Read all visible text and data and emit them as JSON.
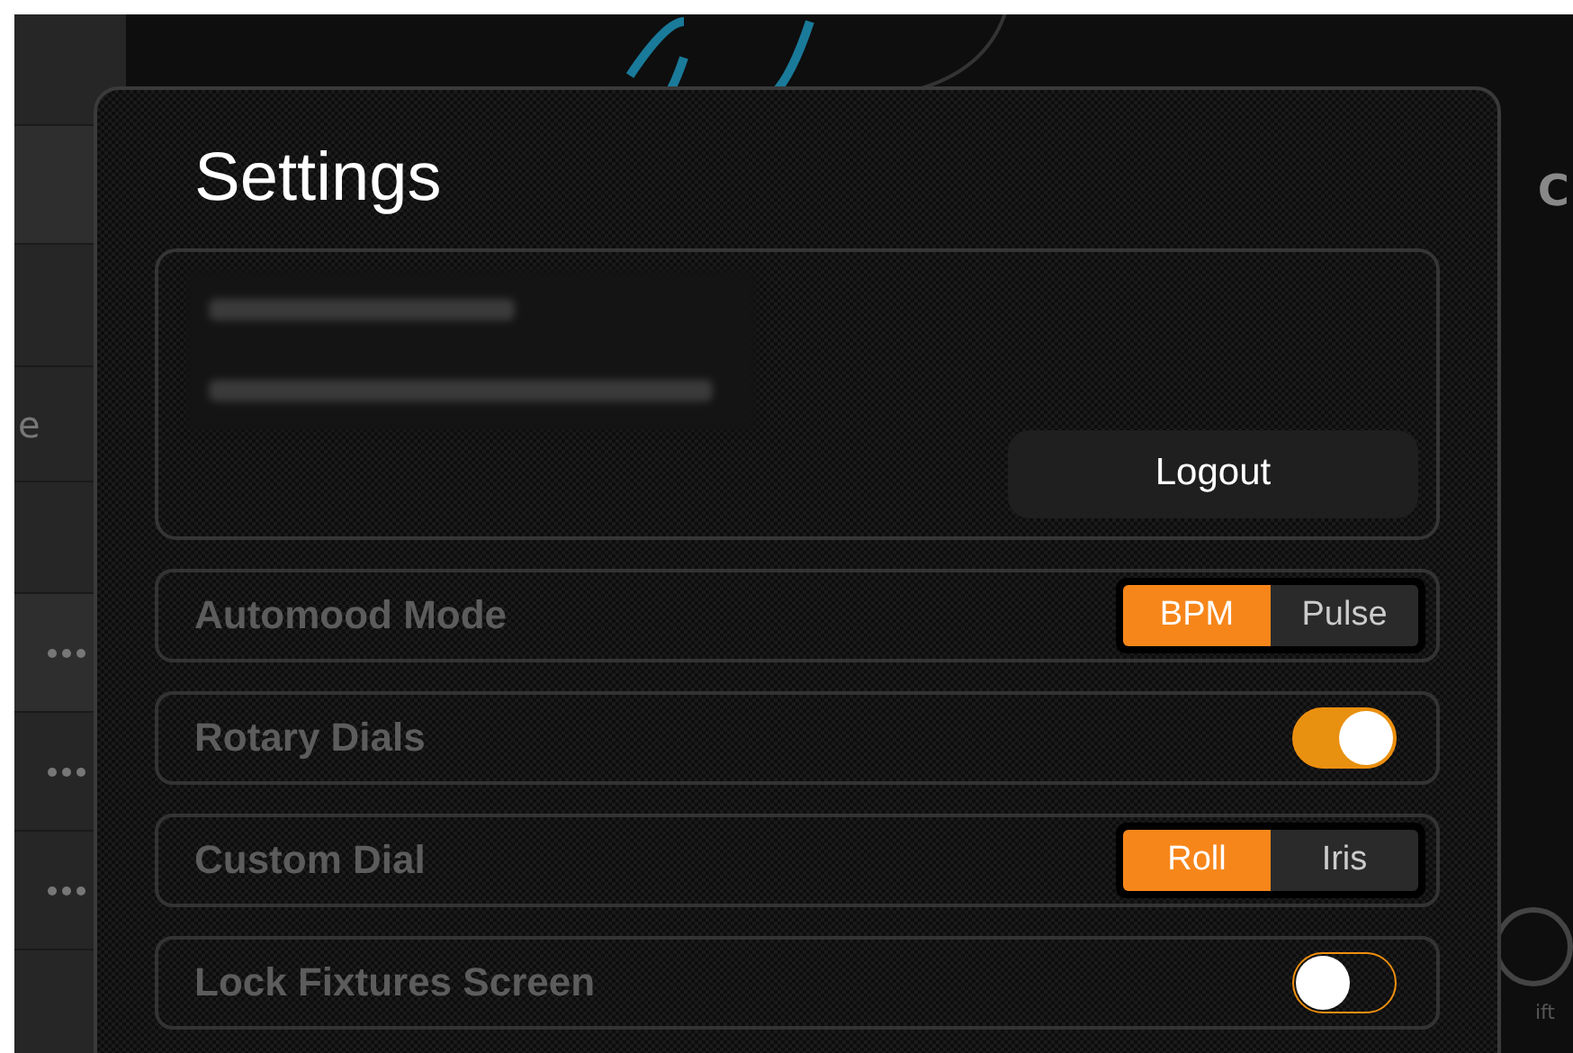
{
  "background": {
    "sidebar_label": "e",
    "side_heading": "C",
    "side_caption": "ift"
  },
  "settings": {
    "title": "Settings",
    "account": {
      "button": "Logout"
    },
    "rows": [
      {
        "kind": "segmented",
        "label": "Automood Mode",
        "options": [
          {
            "label": "BPM",
            "selected": true
          },
          {
            "label": "Pulse",
            "selected": false
          }
        ]
      },
      {
        "kind": "toggle",
        "label": "Rotary Dials",
        "on": true
      },
      {
        "kind": "segmented",
        "label": "Custom Dial",
        "options": [
          {
            "label": "Roll",
            "selected": true
          },
          {
            "label": "Iris",
            "selected": false
          }
        ]
      },
      {
        "kind": "toggle",
        "label": "Lock Fixtures Screen",
        "on": false
      }
    ]
  }
}
